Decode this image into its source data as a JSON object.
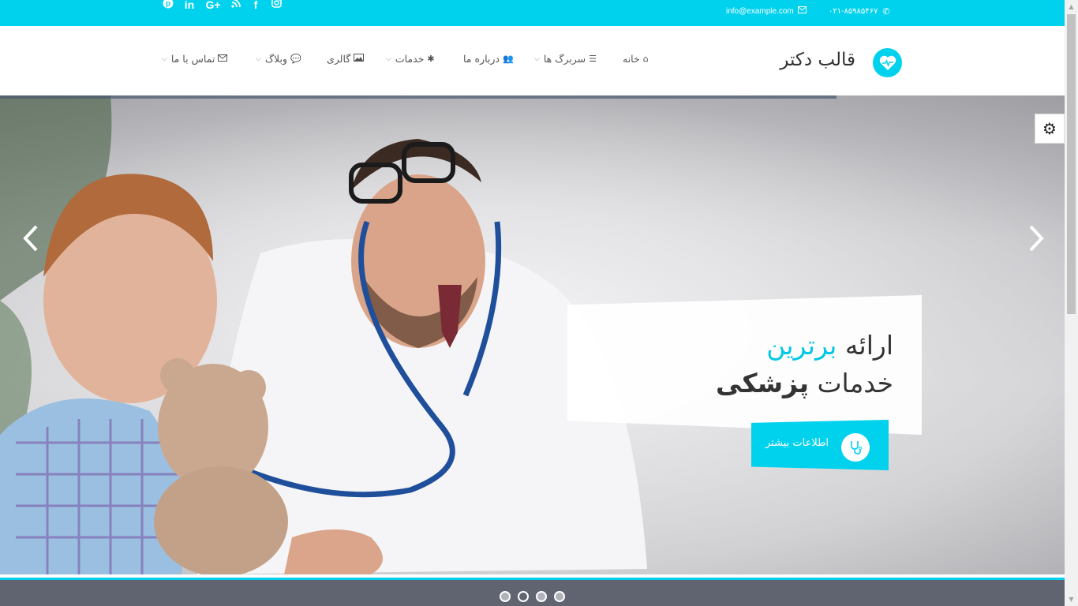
{
  "topbar": {
    "phone": "۰۲۱-۸۵۹۸۵۴۶۷",
    "email": "info@example.com",
    "social": [
      {
        "name": "instagram-icon",
        "glyph": "◘"
      },
      {
        "name": "facebook-icon",
        "glyph": "f"
      },
      {
        "name": "rss-icon",
        "glyph": "◠"
      },
      {
        "name": "google-plus-icon",
        "glyph": "G+"
      },
      {
        "name": "linkedin-icon",
        "glyph": "in"
      },
      {
        "name": "pinterest-icon",
        "glyph": "℗"
      }
    ]
  },
  "header": {
    "logo_text": "قالب دکتر",
    "nav": [
      {
        "label": "خانه",
        "icon": "home-icon",
        "has_dropdown": false
      },
      {
        "label": "سربرگ ها",
        "icon": "bars-icon",
        "has_dropdown": true
      },
      {
        "label": "درباره ما",
        "icon": "users-icon",
        "has_dropdown": false
      },
      {
        "label": "خدمات",
        "icon": "asterisk-icon",
        "has_dropdown": true
      },
      {
        "label": "گالری",
        "icon": "image-icon",
        "has_dropdown": false
      },
      {
        "label": "وبلاگ",
        "icon": "comments-icon",
        "has_dropdown": true
      },
      {
        "label": "تماس با ما",
        "icon": "envelope-icon",
        "has_dropdown": true
      }
    ]
  },
  "slider": {
    "caption_word1": "ارائه",
    "caption_accent": "برترین",
    "caption_word2": "خدمات",
    "caption_bold": "پزشکی",
    "button_label": "اطلاعات بیشتر",
    "prev_glyph": "‹",
    "next_glyph": "›",
    "slide_count": 4,
    "active_slide": 2
  },
  "colors": {
    "accent": "#00d2ee",
    "text": "#333333"
  }
}
